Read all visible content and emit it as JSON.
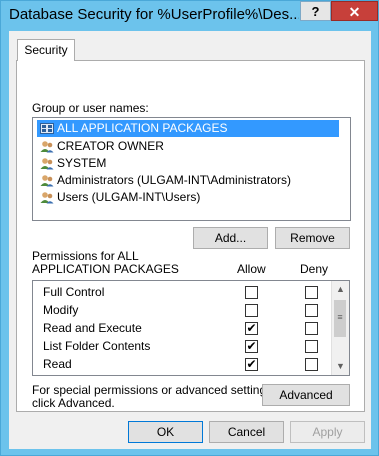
{
  "window": {
    "title": "Database Security for %UserProfile%\\Des...",
    "help_label": "?",
    "close_label": "✕"
  },
  "tab": {
    "label": "Security"
  },
  "groups": {
    "heading": "Group or user names:",
    "items": [
      {
        "label": "ALL APPLICATION PACKAGES",
        "icon": "package-group-icon",
        "selected": true
      },
      {
        "label": "CREATOR OWNER",
        "icon": "users-icon"
      },
      {
        "label": "SYSTEM",
        "icon": "users-icon"
      },
      {
        "label": "Administrators (ULGAM-INT\\Administrators)",
        "icon": "users-icon"
      },
      {
        "label": "Users (ULGAM-INT\\Users)",
        "icon": "users-icon"
      }
    ],
    "add_label": "Add...",
    "remove_label": "Remove"
  },
  "permissions": {
    "heading_line1": "Permissions for ALL",
    "heading_line2": "APPLICATION PACKAGES",
    "allow_header": "Allow",
    "deny_header": "Deny",
    "rows": [
      {
        "name": "Full Control",
        "allow": false,
        "deny": false
      },
      {
        "name": "Modify",
        "allow": false,
        "deny": false
      },
      {
        "name": "Read and Execute",
        "allow": true,
        "deny": false
      },
      {
        "name": "List Folder Contents",
        "allow": true,
        "deny": false
      },
      {
        "name": "Read",
        "allow": true,
        "deny": false
      }
    ]
  },
  "advanced": {
    "text_line1": "For special permissions or advanced settings,",
    "text_line2": "click Advanced.",
    "button_label": "Advanced"
  },
  "footer": {
    "ok_label": "OK",
    "cancel_label": "Cancel",
    "apply_label": "Apply"
  },
  "colors": {
    "title_bar": "#6cc3ec",
    "close_button": "#c7403a",
    "selection": "#3399ff"
  }
}
